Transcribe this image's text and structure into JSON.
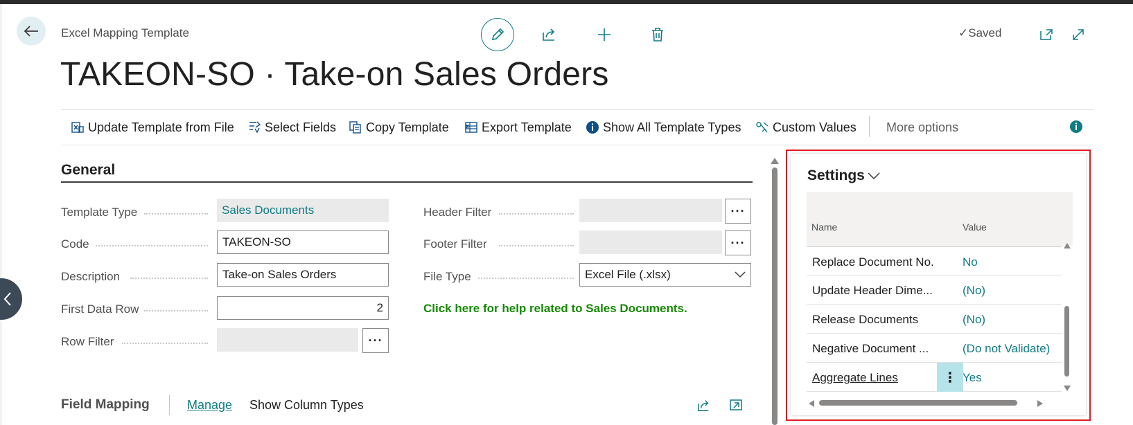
{
  "header": {
    "breadcrumb": "Excel Mapping Template",
    "title": "TAKEON-SO · Take-on Sales Orders",
    "status": "Saved",
    "icons": [
      "back-arrow-icon",
      "edit-pencil-icon",
      "share-icon",
      "add-icon",
      "delete-icon",
      "open-new-window-icon",
      "expand-icon"
    ]
  },
  "actions": {
    "update_template": "Update Template from File",
    "select_fields": "Select Fields",
    "copy_template": "Copy Template",
    "export_template": "Export Template",
    "show_all_types": "Show All Template Types",
    "custom_values": "Custom Values",
    "more_options": "More options"
  },
  "general": {
    "section_title": "General",
    "template_type": {
      "label": "Template Type",
      "value": "Sales Documents"
    },
    "code": {
      "label": "Code",
      "value": "TAKEON-SO"
    },
    "description": {
      "label": "Description",
      "value": "Take-on Sales Orders"
    },
    "first_data_row": {
      "label": "First Data Row",
      "value": "2"
    },
    "row_filter": {
      "label": "Row Filter",
      "value": ""
    },
    "header_filter": {
      "label": "Header Filter",
      "value": ""
    },
    "footer_filter": {
      "label": "Footer Filter",
      "value": ""
    },
    "file_type": {
      "label": "File Type",
      "value": "Excel File (.xlsx)"
    },
    "help_link": "Click here for help related to Sales Documents."
  },
  "field_mapping": {
    "title": "Field Mapping",
    "manage": "Manage",
    "show_column_types": "Show Column Types"
  },
  "settings": {
    "title": "Settings",
    "col_name": "Name",
    "col_value": "Value",
    "rows": [
      {
        "name": "Replace Document No.",
        "value": "No"
      },
      {
        "name": "Update Header Dime...",
        "value": "(No)"
      },
      {
        "name": "Release Documents",
        "value": "(No)"
      },
      {
        "name": "Negative Document ...",
        "value": "(Do not Validate)"
      },
      {
        "name": "Aggregate Lines",
        "value": "Yes"
      }
    ]
  },
  "colors": {
    "accent": "#0e7c86",
    "highlight_border": "#e11b22",
    "help_link": "#138a00",
    "selected_cell": "#b6e3ea"
  }
}
